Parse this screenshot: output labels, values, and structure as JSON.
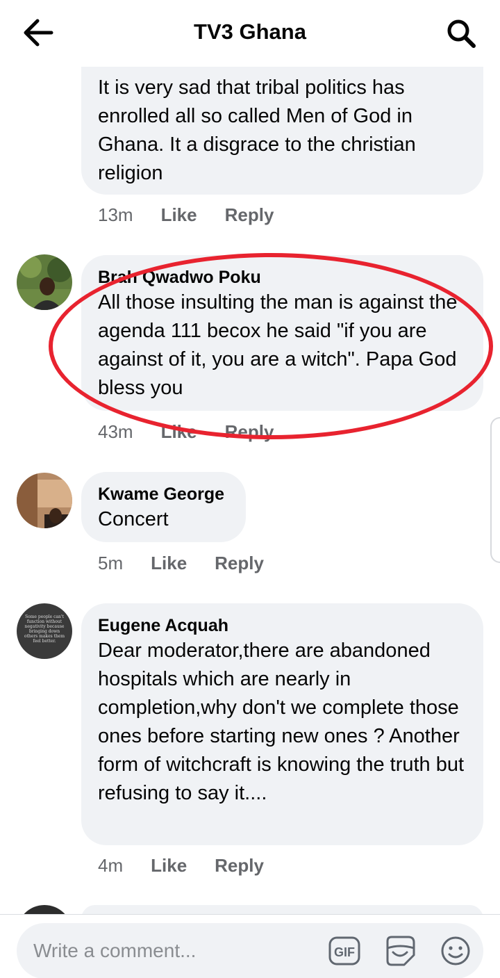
{
  "header": {
    "title": "TV3 Ghana",
    "back_icon": "arrow-left-icon",
    "search_icon": "search-icon"
  },
  "comments": [
    {
      "author": "",
      "text": "It is very sad that tribal politics has enrolled all so called Men of God in Ghana. It a disgrace to the christian religion",
      "time": "13m",
      "like": "Like",
      "reply": "Reply"
    },
    {
      "author": "Brah Qwadwo Poku",
      "text": "All those insulting the man is against the agenda 111 becox he said \"if you are against of it, you are a witch\". Papa God bless you",
      "time": "43m",
      "like": "Like",
      "reply": "Reply"
    },
    {
      "author": "Kwame George",
      "text": "Concert",
      "time": "5m",
      "like": "Like",
      "reply": "Reply"
    },
    {
      "author": "Eugene Acquah",
      "text": "Dear moderator,there are abandoned hospitals which are nearly in completion,why don't we complete those ones before starting new ones ? Another form of witchcraft is knowing the truth but refusing to say it....",
      "time": "4m",
      "like": "Like",
      "reply": "Reply",
      "avatar_text": "Some people can't function without negativity because bringing down others makes them feel better."
    }
  ],
  "composer": {
    "placeholder": "Write a comment...",
    "gif_label": "GIF"
  },
  "colors": {
    "bubble": "#f0f2f5",
    "meta": "#65676b",
    "annotation": "#e8232f"
  }
}
